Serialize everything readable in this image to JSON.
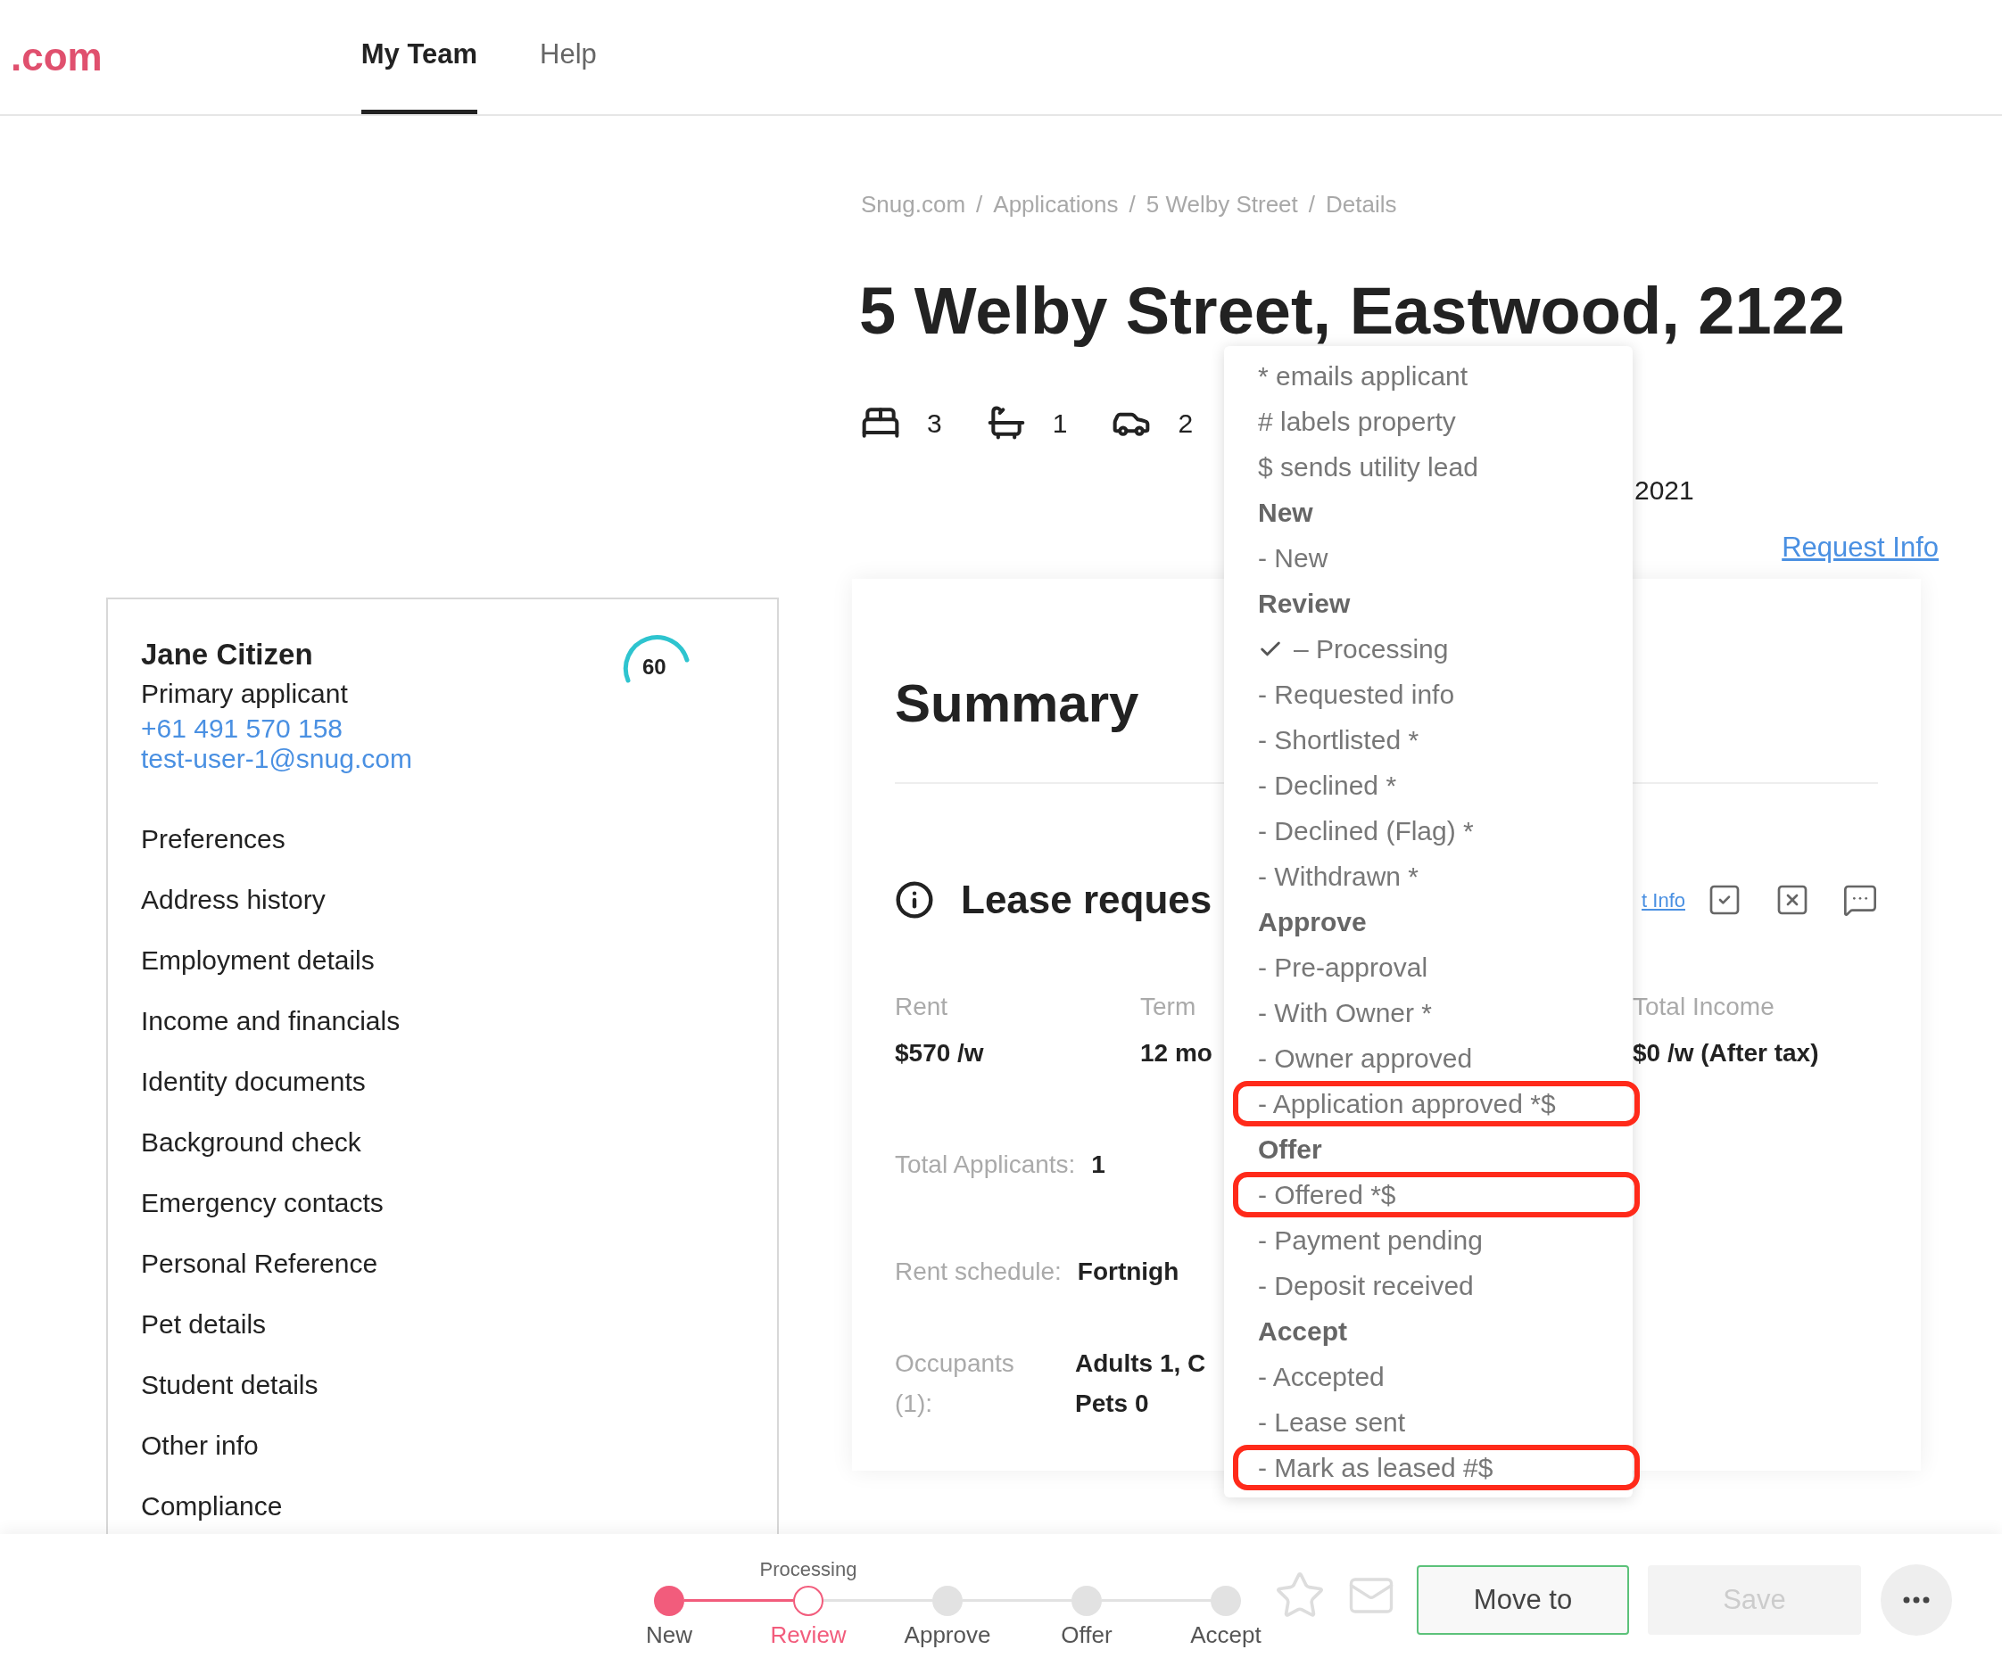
{
  "header": {
    "logo": ".com",
    "nav": [
      {
        "label": "My Team",
        "selected": true
      },
      {
        "label": "Help",
        "selected": false
      }
    ]
  },
  "breadcrumb": [
    "Snug.com",
    "Applications",
    "5 Welby Street",
    "Details"
  ],
  "breadcrumb_separator": "/",
  "title": "5 Welby Street, Eastwood, 2122",
  "features": [
    {
      "kind": "bed",
      "value": "3"
    },
    {
      "kind": "bath",
      "value": "1"
    },
    {
      "kind": "car",
      "value": "2"
    }
  ],
  "date_partial": "2021",
  "request_info_link": "Request Info",
  "applicant": {
    "name": "Jane Citizen",
    "role": "Primary applicant",
    "phone": "+61 491 570 158",
    "email": "test-user-1@snug.com",
    "score": "60",
    "sections": [
      "Preferences",
      "Address history",
      "Employment details",
      "Income and financials",
      "Identity documents",
      "Background check",
      "Emergency contacts",
      "Personal Reference",
      "Pet details",
      "Student details",
      "Other info",
      "Compliance"
    ]
  },
  "summary": {
    "heading": "Summary",
    "lease_title": "Lease reques",
    "request_link": "t Info",
    "columns": [
      {
        "label": "Rent",
        "value": "$570 /w"
      },
      {
        "label": "Term",
        "value": "12 mo"
      },
      {
        "label": "Total Income",
        "value": "$0 /w (After tax)"
      }
    ],
    "total_applicants": {
      "label": "Total Applicants:",
      "value": "1"
    },
    "rent_schedule": {
      "label": "Rent schedule:",
      "value": "Fortnigh"
    },
    "occupants": {
      "label_lines": [
        "Occupants",
        "(1):"
      ],
      "value_lines": [
        "Adults 1, C",
        "Pets 0"
      ]
    }
  },
  "status_menu": [
    {
      "kind": "note",
      "label": "* emails applicant"
    },
    {
      "kind": "note",
      "label": "# labels property"
    },
    {
      "kind": "note",
      "label": "$ sends utility lead"
    },
    {
      "kind": "group",
      "label": "New"
    },
    {
      "kind": "option",
      "label": "- New",
      "checked": false,
      "highlighted": false
    },
    {
      "kind": "group",
      "label": "Review"
    },
    {
      "kind": "option",
      "label": "– Processing",
      "checked": true,
      "highlighted": false
    },
    {
      "kind": "option",
      "label": "- Requested info",
      "checked": false,
      "highlighted": false
    },
    {
      "kind": "option",
      "label": "- Shortlisted *",
      "checked": false,
      "highlighted": false
    },
    {
      "kind": "option",
      "label": "- Declined *",
      "checked": false,
      "highlighted": false
    },
    {
      "kind": "option",
      "label": "- Declined (Flag) *",
      "checked": false,
      "highlighted": false
    },
    {
      "kind": "option",
      "label": "- Withdrawn *",
      "checked": false,
      "highlighted": false
    },
    {
      "kind": "group",
      "label": "Approve"
    },
    {
      "kind": "option",
      "label": "- Pre-approval",
      "checked": false,
      "highlighted": false
    },
    {
      "kind": "option",
      "label": "- With Owner *",
      "checked": false,
      "highlighted": false
    },
    {
      "kind": "option",
      "label": "- Owner approved",
      "checked": false,
      "highlighted": false
    },
    {
      "kind": "option",
      "label": "- Application approved *$",
      "checked": false,
      "highlighted": true
    },
    {
      "kind": "group",
      "label": "Offer"
    },
    {
      "kind": "option",
      "label": "- Offered *$",
      "checked": false,
      "highlighted": true
    },
    {
      "kind": "option",
      "label": "- Payment pending",
      "checked": false,
      "highlighted": false
    },
    {
      "kind": "option",
      "label": "- Deposit received",
      "checked": false,
      "highlighted": false
    },
    {
      "kind": "group",
      "label": "Accept"
    },
    {
      "kind": "option",
      "label": "- Accepted",
      "checked": false,
      "highlighted": false
    },
    {
      "kind": "option",
      "label": "- Lease sent",
      "checked": false,
      "highlighted": false
    },
    {
      "kind": "option",
      "label": "- Mark as leased #$",
      "checked": false,
      "highlighted": true
    }
  ],
  "steps": [
    {
      "label": "New",
      "kind": "done"
    },
    {
      "label": "Review",
      "kind": "current",
      "caption": "Processing"
    },
    {
      "label": "Approve",
      "kind": "pending"
    },
    {
      "label": "Offer",
      "kind": "pending"
    },
    {
      "label": "Accept",
      "kind": "pending"
    }
  ],
  "actions": {
    "move_to": "Move to",
    "save": "Save",
    "save_disabled": true
  }
}
